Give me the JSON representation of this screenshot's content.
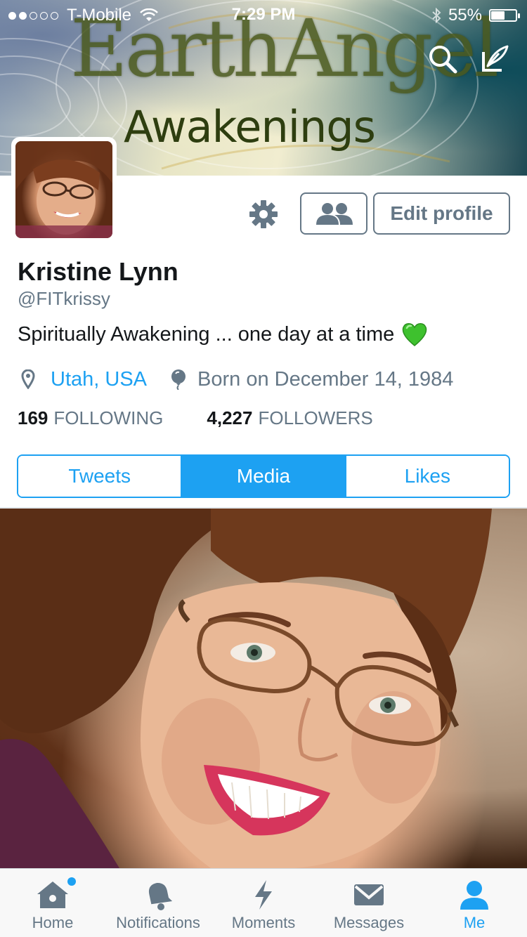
{
  "status_bar": {
    "carrier": "T-Mobile",
    "signal_bars_filled": 2,
    "signal_bars_total": 5,
    "time": "7:29 PM",
    "battery_percent": "55%",
    "battery_level": 0.55
  },
  "header": {
    "banner_title": "EarthAngel",
    "banner_subtitle": "Awakenings",
    "search_icon": "search-icon",
    "compose_icon": "compose-icon"
  },
  "profile": {
    "name": "Kristine Lynn",
    "handle": "@FITkrissy",
    "bio": "Spiritually Awakening ... one day at a time",
    "bio_emoji": "green-heart",
    "location": "Utah, USA",
    "birthday": "Born on December 14, 1984",
    "following_count": "169",
    "following_label": "FOLLOWING",
    "followers_count": "4,227",
    "followers_label": "FOLLOWERS"
  },
  "actions": {
    "settings_icon": "gear-icon",
    "follow_icon": "people-icon",
    "edit_profile_label": "Edit profile"
  },
  "tabs": [
    {
      "label": "Tweets",
      "active": false
    },
    {
      "label": "Media",
      "active": true
    },
    {
      "label": "Likes",
      "active": false
    }
  ],
  "tab_bar": [
    {
      "label": "Home",
      "icon": "home-icon",
      "badge": true,
      "active": false
    },
    {
      "label": "Notifications",
      "icon": "bell-icon",
      "badge": false,
      "active": false
    },
    {
      "label": "Moments",
      "icon": "lightning-icon",
      "badge": false,
      "active": false
    },
    {
      "label": "Messages",
      "icon": "envelope-icon",
      "badge": false,
      "active": false
    },
    {
      "label": "Me",
      "icon": "person-icon",
      "badge": false,
      "active": true
    }
  ],
  "colors": {
    "accent": "#1da1f2",
    "secondary_text": "#657786",
    "primary_text": "#14171a"
  }
}
